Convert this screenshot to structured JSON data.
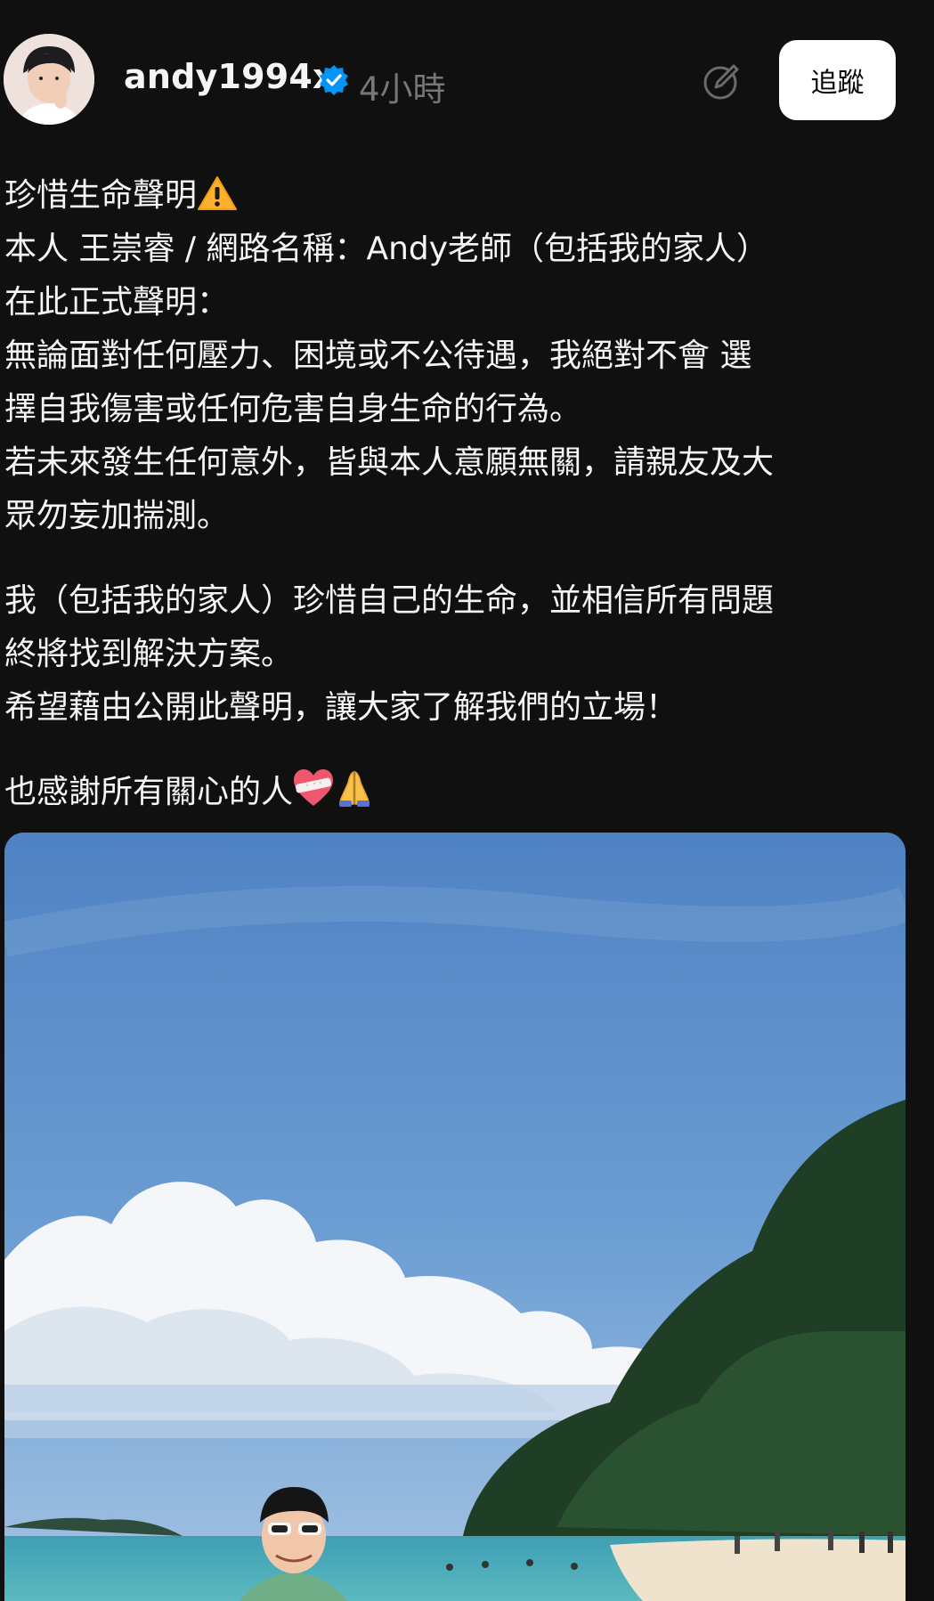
{
  "header": {
    "username": "andy1994x",
    "timestamp": "4小時",
    "follow_label": "追蹤"
  },
  "post": {
    "paragraphs": [
      {
        "lines": [
          "珍惜生命聲明",
          "本人 王崇睿 / 網路名稱：Andy老師（包括我的家人）",
          "在此正式聲明：",
          "無論面對任何壓力、困境或不公待遇，我絕對不會 選",
          "擇自我傷害或任何危害自身生命的行為。",
          "若未來發生任何意外，皆與本人意願無關，請親友及大",
          "眾勿妄加揣測。"
        ]
      },
      {
        "lines": [
          "我（包括我的家人）珍惜自己的生命，並相信所有問題",
          "終將找到解決方案。",
          "希望藉由公開此聲明，讓大家了解我們的立場！"
        ]
      },
      {
        "lines": [
          "也感謝所有關心的人"
        ]
      }
    ]
  },
  "icons": {
    "warning": "warning-icon",
    "heart": "mending-heart-icon",
    "pray": "folded-hands-icon",
    "verified": "verified-badge-icon",
    "edit": "edit-circle-icon"
  },
  "colors": {
    "background": "#101010",
    "text": "#f3f5f7",
    "muted": "#777777",
    "verified": "#0095f6",
    "button_bg": "#ffffff"
  }
}
